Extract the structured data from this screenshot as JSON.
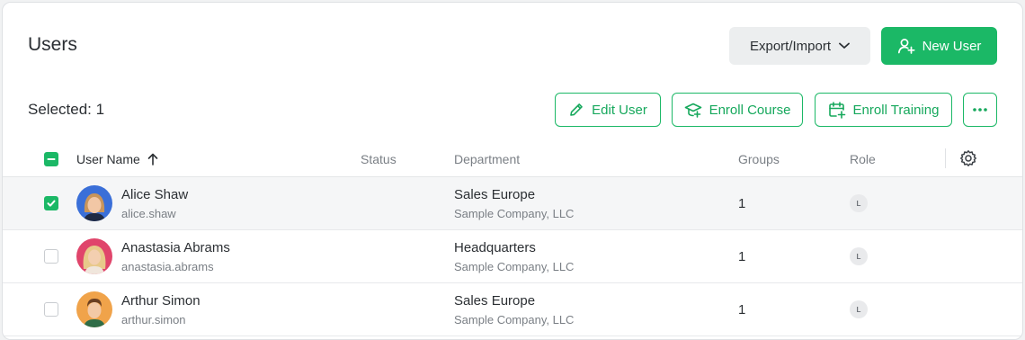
{
  "header": {
    "title": "Users",
    "export_label": "Export/Import",
    "new_user_label": "New User"
  },
  "toolbar": {
    "selected_label": "Selected: 1",
    "edit_user_label": "Edit User",
    "enroll_course_label": "Enroll Course",
    "enroll_training_label": "Enroll Training"
  },
  "columns": {
    "username": "User Name",
    "status": "Status",
    "department": "Department",
    "groups": "Groups",
    "role": "Role"
  },
  "rows": [
    {
      "name": "Alice Shaw",
      "login": "alice.shaw",
      "department": "Sales Europe",
      "company": "Sample Company, LLC",
      "groups": "1",
      "role": "L",
      "checked": true
    },
    {
      "name": "Anastasia Abrams",
      "login": "anastasia.abrams",
      "department": "Headquarters",
      "company": "Sample Company, LLC",
      "groups": "1",
      "role": "L",
      "checked": false
    },
    {
      "name": "Arthur Simon",
      "login": "arthur.simon",
      "department": "Sales Europe",
      "company": "Sample Company, LLC",
      "groups": "1",
      "role": "L",
      "checked": false
    }
  ],
  "colors": {
    "accent": "#1bb866",
    "avatar_bg_1": "#3a6fd8",
    "avatar_bg_2": "#e0456b",
    "avatar_bg_3": "#f0a34a"
  },
  "icons": [
    "chevron-down-icon",
    "add-user-icon",
    "pencil-icon",
    "graduation-cap-icon",
    "calendar-add-icon",
    "more-icon",
    "sort-up-icon",
    "gear-icon"
  ]
}
